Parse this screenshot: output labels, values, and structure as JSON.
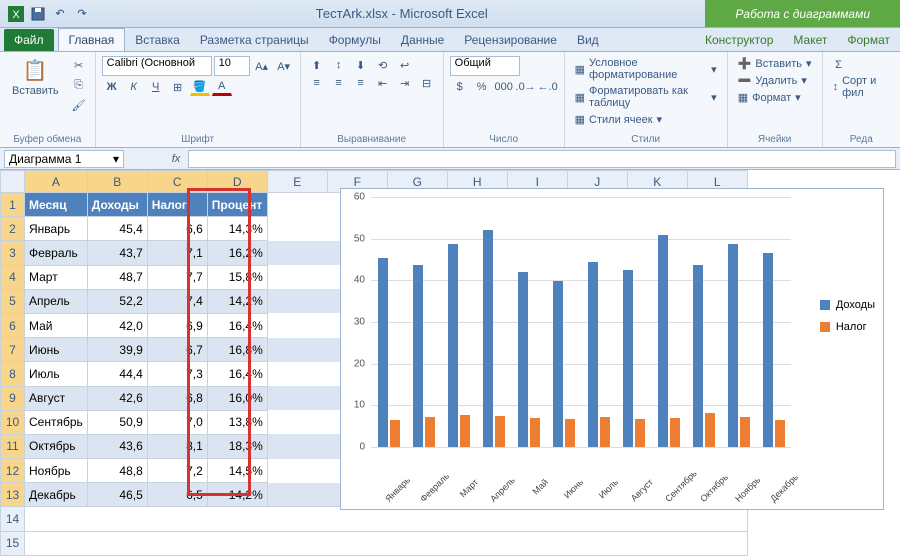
{
  "title": "ТестArk.xlsx - Microsoft Excel",
  "chart_tools_label": "Работа с диаграммами",
  "tabs": {
    "file": "Файл",
    "home": "Главная",
    "insert": "Вставка",
    "layout": "Разметка страницы",
    "formulas": "Формулы",
    "data": "Данные",
    "review": "Рецензирование",
    "view": "Вид",
    "design": "Конструктор",
    "chart_layout": "Макет",
    "format": "Формат"
  },
  "ribbon": {
    "clipboard": {
      "paste": "Вставить",
      "label": "Буфер обмена"
    },
    "font": {
      "name": "Calibri (Основной",
      "size": "10",
      "label": "Шрифт"
    },
    "alignment": {
      "label": "Выравнивание"
    },
    "number": {
      "format": "Общий",
      "label": "Число"
    },
    "styles": {
      "cond": "Условное форматирование",
      "table": "Форматировать как таблицу",
      "cell": "Стили ячеек",
      "label": "Стили"
    },
    "cells": {
      "insert": "Вставить",
      "delete": "Удалить",
      "format": "Формат",
      "label": "Ячейки"
    },
    "editing": {
      "sort": "Сорт и фил",
      "label": "Реда"
    }
  },
  "namebox": "Диаграмма 1",
  "fx": "fx",
  "columns": [
    "A",
    "B",
    "C",
    "D",
    "E",
    "F",
    "G",
    "H",
    "I",
    "J",
    "K",
    "L"
  ],
  "headers": {
    "a": "Месяц",
    "b": "Доходы",
    "c": "Налог",
    "d": "Процент"
  },
  "rows": [
    {
      "n": 2,
      "m": "Январь",
      "inc": "45,4",
      "tax": "6,6",
      "pct": "14,3%"
    },
    {
      "n": 3,
      "m": "Февраль",
      "inc": "43,7",
      "tax": "7,1",
      "pct": "16,2%"
    },
    {
      "n": 4,
      "m": "Март",
      "inc": "48,7",
      "tax": "7,7",
      "pct": "15,8%"
    },
    {
      "n": 5,
      "m": "Апрель",
      "inc": "52,2",
      "tax": "7,4",
      "pct": "14,2%"
    },
    {
      "n": 6,
      "m": "Май",
      "inc": "42,0",
      "tax": "6,9",
      "pct": "16,4%"
    },
    {
      "n": 7,
      "m": "Июнь",
      "inc": "39,9",
      "tax": "6,7",
      "pct": "16,8%"
    },
    {
      "n": 8,
      "m": "Июль",
      "inc": "44,4",
      "tax": "7,3",
      "pct": "16,4%"
    },
    {
      "n": 9,
      "m": "Август",
      "inc": "42,6",
      "tax": "6,8",
      "pct": "16,0%"
    },
    {
      "n": 10,
      "m": "Сентябрь",
      "inc": "50,9",
      "tax": "7,0",
      "pct": "13,8%"
    },
    {
      "n": 11,
      "m": "Октябрь",
      "inc": "43,6",
      "tax": "8,1",
      "pct": "18,3%"
    },
    {
      "n": 12,
      "m": "Ноябрь",
      "inc": "48,8",
      "tax": "7,2",
      "pct": "14,5%"
    },
    {
      "n": 13,
      "m": "Декабрь",
      "inc": "46,5",
      "tax": "6,5",
      "pct": "14,2%"
    }
  ],
  "chart_data": {
    "type": "bar",
    "categories": [
      "Январь",
      "Февраль",
      "Март",
      "Апрель",
      "Май",
      "Июнь",
      "Июль",
      "Август",
      "Сентябрь",
      "Октябрь",
      "Ноябрь",
      "Декабрь"
    ],
    "series": [
      {
        "name": "Доходы",
        "values": [
          45.4,
          43.7,
          48.7,
          52.2,
          42.0,
          39.9,
          44.4,
          42.6,
          50.9,
          43.6,
          48.8,
          46.5
        ],
        "color": "#4f81bd"
      },
      {
        "name": "Налог",
        "values": [
          6.6,
          7.1,
          7.7,
          7.4,
          6.9,
          6.7,
          7.3,
          6.8,
          7.0,
          8.1,
          7.2,
          6.5
        ],
        "color": "#ed7d31"
      }
    ],
    "ylim": [
      0,
      60
    ],
    "yticks": [
      0,
      10,
      20,
      30,
      40,
      50,
      60
    ]
  }
}
